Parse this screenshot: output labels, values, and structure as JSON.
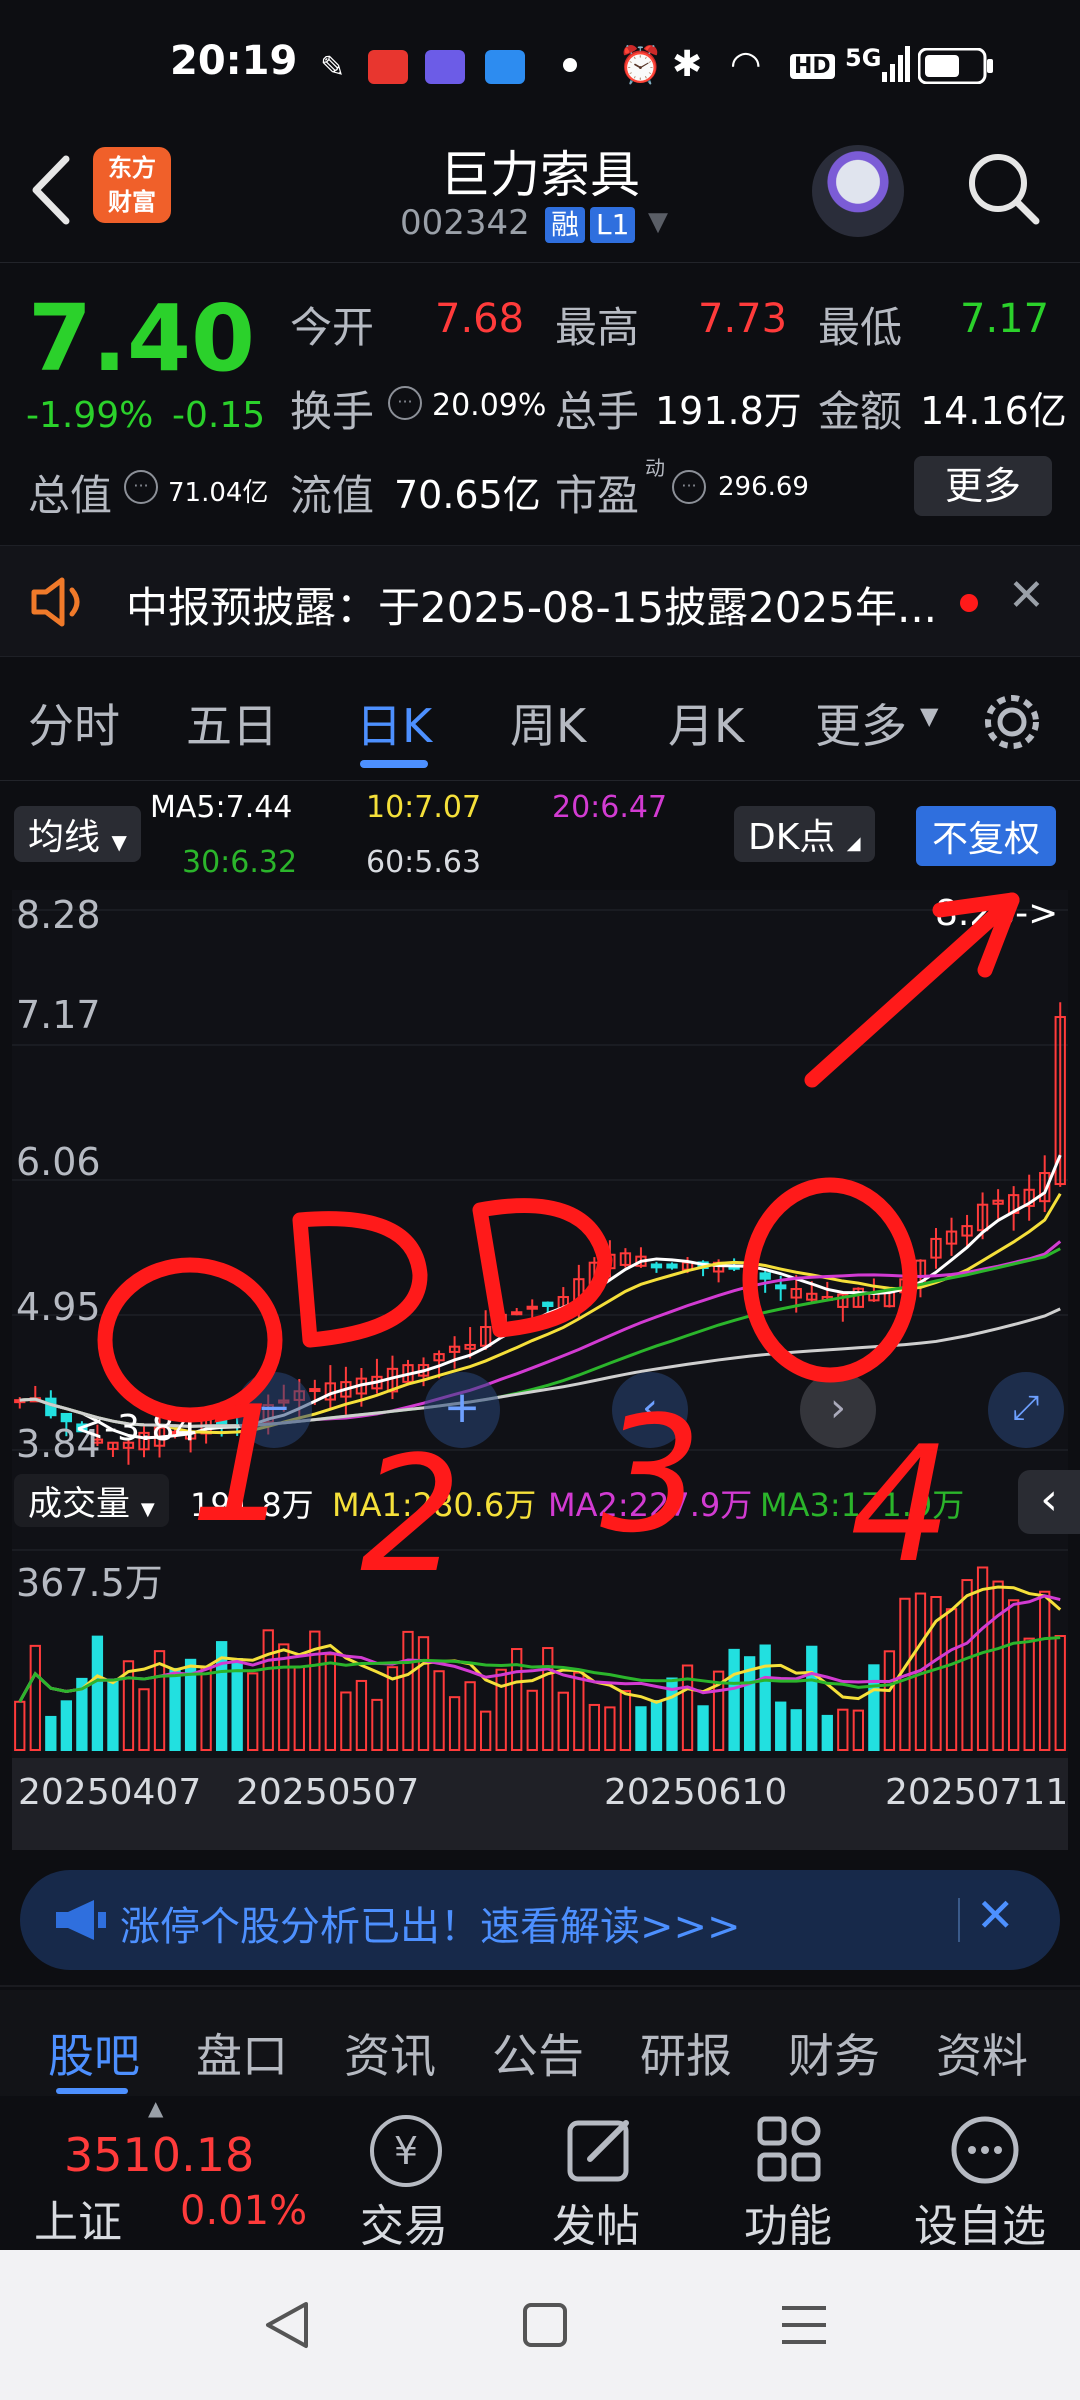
{
  "status_bar": {
    "time": "20:19",
    "network": "5G",
    "hd": "HD"
  },
  "header": {
    "title": "巨力索具",
    "code": "002342",
    "margin_tag": "融",
    "level_tag": "L1",
    "logo_line1": "东方",
    "logo_line2": "财富"
  },
  "quote": {
    "price": "7.40",
    "change_pct": "-1.99%",
    "change_abs": "-0.15",
    "open_label": "今开",
    "open": "7.68",
    "high_label": "最高",
    "high": "7.73",
    "low_label": "最低",
    "low": "7.17",
    "turnover_label": "换手",
    "turnover": "20.09%",
    "volume_label": "总手",
    "volume": "191.8万",
    "amount_label": "金额",
    "amount": "14.16亿",
    "total_value_label": "总值",
    "total_value": "71.04亿",
    "float_value_label": "流值",
    "float_value": "70.65亿",
    "pe_label": "市盈",
    "pe_sup": "动",
    "pe": "296.69",
    "more_label": "更多"
  },
  "notice": {
    "text": "中报预披露：于2025-08-15披露2025年..."
  },
  "chart_tabs": [
    "分时",
    "五日",
    "日K",
    "周K",
    "月K",
    "更多"
  ],
  "chart_tab_active": 2,
  "indicators": {
    "ma_selector": "均线",
    "ma5": "MA5:7.44",
    "ma10": "10:7.07",
    "ma20": "20:6.47",
    "ma30": "30:6.32",
    "ma60": "60:5.63",
    "dk_label": "DK点",
    "adjust_label": "不复权"
  },
  "price_axis": [
    "8.28",
    "7.17",
    "6.06",
    "4.95",
    "3.84"
  ],
  "low_marker": "3.84",
  "high_marker": "8.28->",
  "volume_panel": {
    "selector": "成交量",
    "vol": "191.8万",
    "ma1": "MA1:280.6万",
    "ma2": "MA2:227.9万",
    "ma3": "MA3:171.9万",
    "axis_max": "367.5万"
  },
  "dates": [
    "20250407",
    "20250507",
    "20250610",
    "20250711"
  ],
  "banner": {
    "text": "涨停个股分析已出！速看解读>>>"
  },
  "bottom_tabs": [
    "股吧",
    "盘口",
    "资讯",
    "公告",
    "研报",
    "财务",
    "资料"
  ],
  "bottom_tab_active": 0,
  "index": {
    "value": "3510.18",
    "name": "上证",
    "change": "0.01%"
  },
  "toolbar": {
    "trade": "交易",
    "post": "发帖",
    "functions": "功能",
    "watchlist": "设自选"
  },
  "handwriting": [
    "1",
    "2",
    "3",
    "4"
  ],
  "colors": {
    "up": "#ff3b3b",
    "down": "#2bd12b",
    "accent": "#4d90ff",
    "ma5": "#ffffff",
    "ma10": "#f5e03a",
    "ma20": "#d23bd2",
    "ma30": "#2bb52b",
    "ma60": "#cfcfcf",
    "annotation": "#ff1a1a"
  }
}
